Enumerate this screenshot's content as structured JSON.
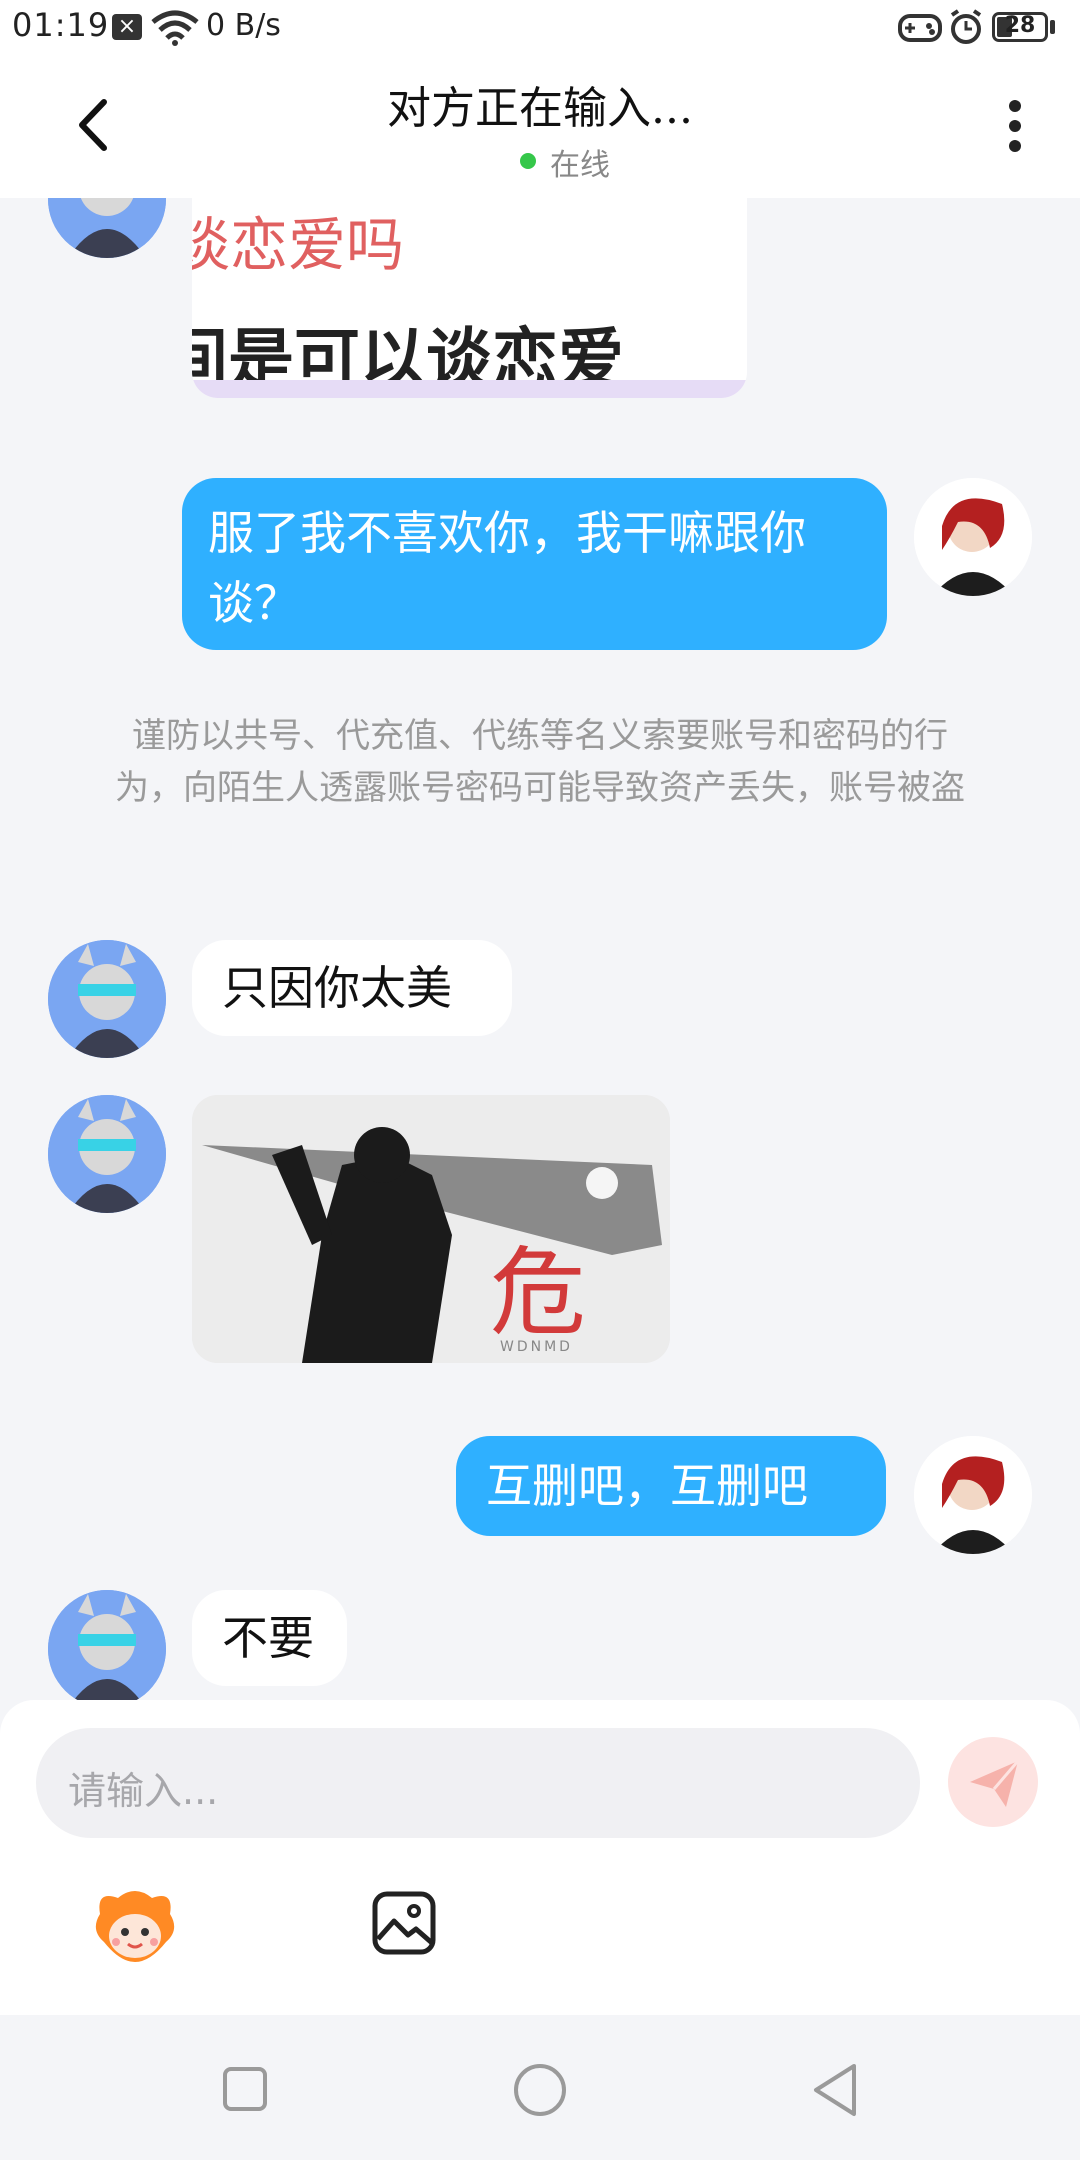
{
  "status_bar": {
    "time": "01:19",
    "net_rate": "0 B/s",
    "battery": "28"
  },
  "header": {
    "title": "对方正在输入...",
    "status": "在线"
  },
  "messages": {
    "m1_text": "服了我不喜欢你，我干嘛跟你谈？",
    "notice": "谨防以共号、代充值、代练等名义索要账号和密码的行为，向陌生人透露账号密码可能导致资产丢失，账号被盗",
    "m2_text": "只因你太美",
    "m3_img_text": "危",
    "m3_img_caption": "WDNMD",
    "m4_text": "互删吧，互删吧",
    "m5_text": "不要",
    "top_img_line1": "谈恋爱吗",
    "top_img_line2": "间是可以谈恋爱"
  },
  "composer": {
    "placeholder": "请输入..."
  },
  "colors": {
    "accent": "#2fb0ff",
    "online": "#35c74a"
  }
}
